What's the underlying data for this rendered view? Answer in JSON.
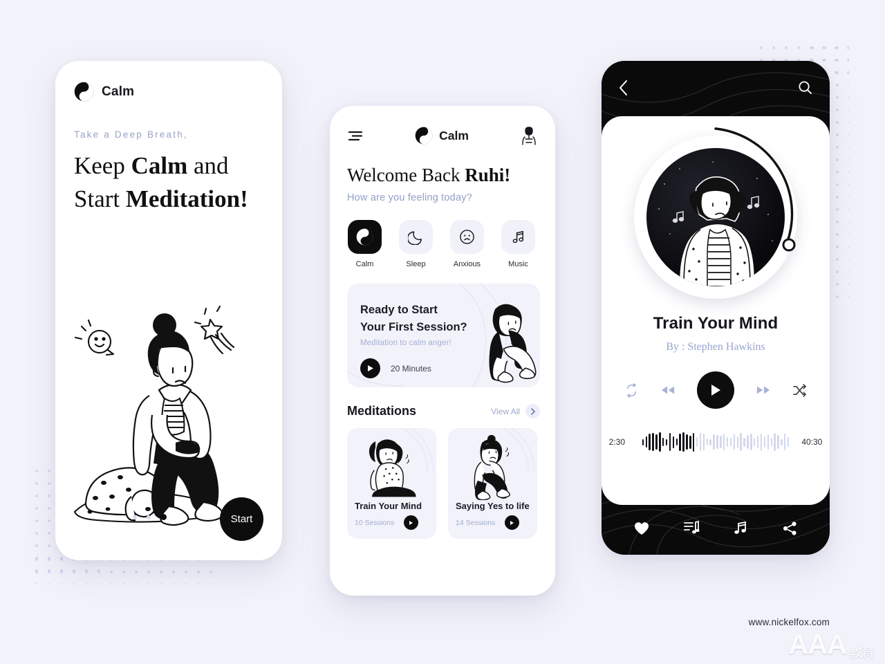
{
  "background": {
    "page_color": "#f2f2fa",
    "accent_dark": "#0d0d0d",
    "muted_blue": "#98a4cf"
  },
  "screen_one": {
    "brand": "Calm",
    "brand_icon": "yin-yang-icon",
    "eyebrow": "Take a Deep Breath,",
    "headline_line1_pre": "Keep ",
    "headline_line1_bold": "Calm",
    "headline_line1_post": " and",
    "headline_line2_pre": "Start ",
    "headline_line2_bold": "Meditation!",
    "start_label": "Start",
    "pager": {
      "count": 3,
      "active_index": 2
    }
  },
  "screen_two": {
    "menu_icon": "hamburger-menu-icon",
    "brand": "Calm",
    "brand_icon": "yin-yang-icon",
    "avatar_icon": "user-avatar-icon",
    "welcome_pre": "Welcome Back ",
    "welcome_bold": "Ruhi!",
    "subtitle": "How are you feeling today?",
    "categories": [
      {
        "label": "Calm",
        "icon": "yin-yang-icon",
        "active": true
      },
      {
        "label": "Sleep",
        "icon": "moon-icon",
        "active": false
      },
      {
        "label": "Anxious",
        "icon": "sad-face-icon",
        "active": false
      },
      {
        "label": "Music",
        "icon": "music-note-icon",
        "active": false
      }
    ],
    "session_card": {
      "title_line1": "Ready to Start",
      "title_line2": "Your First Session?",
      "note": "Meditation to calm anger!",
      "duration": "20 Minutes",
      "play_icon": "play-icon"
    },
    "section_title": "Meditations",
    "view_all_label": "View All",
    "view_all_icon": "chevron-right-icon",
    "meditations": [
      {
        "title": "Train Your Mind",
        "sessions": "10 Sessions",
        "play_icon": "play-icon"
      },
      {
        "title": "Saying Yes to life",
        "sessions": "14 Sessions",
        "play_icon": "play-icon"
      }
    ]
  },
  "screen_three": {
    "back_icon": "chevron-left-icon",
    "search_icon": "search-icon",
    "artwork_icon": "album-art-illustration",
    "track_title": "Train Your Mind",
    "track_artist": "By : Stephen Hawkins",
    "controls": [
      {
        "name": "repeat-button",
        "icon": "repeat-icon"
      },
      {
        "name": "rewind-button",
        "icon": "rewind-icon"
      },
      {
        "name": "play-button",
        "icon": "play-icon"
      },
      {
        "name": "forward-button",
        "icon": "fast-forward-icon"
      },
      {
        "name": "shuffle-button",
        "icon": "shuffle-icon"
      }
    ],
    "elapsed_time": "2:30",
    "total_time": "40:30",
    "progress_percent": 37,
    "bottom_nav": [
      {
        "name": "favorite-button",
        "icon": "heart-icon"
      },
      {
        "name": "playlist-button",
        "icon": "playlist-icon"
      },
      {
        "name": "music-button",
        "icon": "music-note-icon"
      },
      {
        "name": "share-button",
        "icon": "share-icon"
      }
    ]
  },
  "footer": {
    "site": "www.nickelfox.com",
    "watermark": "AAA",
    "watermark_sub": "教育"
  }
}
